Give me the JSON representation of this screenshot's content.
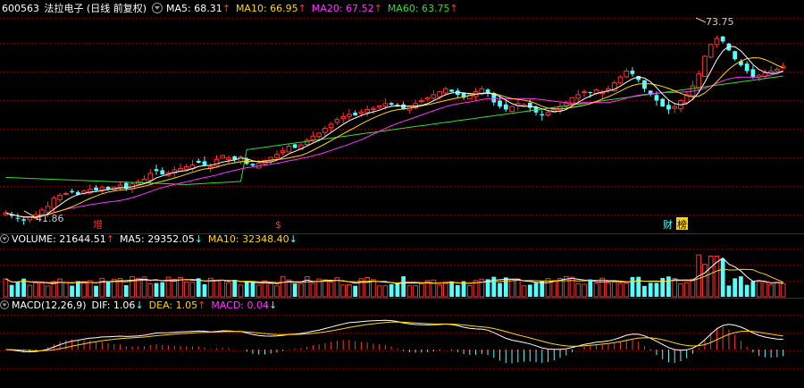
{
  "header": {
    "stock_code": "600563",
    "stock_name": "法拉电子",
    "period": "(日线 前复权)",
    "ma": [
      {
        "label": "MA5: 68.31",
        "color": "#ffffff"
      },
      {
        "label": "MA10: 66.95",
        "color": "#ffd700"
      },
      {
        "label": "MA20: 67.52",
        "color": "#ff33ff"
      },
      {
        "label": "MA60: 63.75",
        "color": "#33dd33"
      }
    ],
    "arrow_up": "↑",
    "arrow_down": "↓"
  },
  "volume_header": [
    {
      "label": "VOLUME: 21644.51",
      "color": "#ffffff",
      "arrow": "↑"
    },
    {
      "label": "MA5: 29352.05",
      "color": "#ffffff",
      "arrow": "↓"
    },
    {
      "label": "MA10: 32348.40",
      "color": "#ffd700",
      "arrow": "↓"
    }
  ],
  "macd_header": [
    {
      "label": "MACD(12,26,9)",
      "color": "#ffffff",
      "arrow": ""
    },
    {
      "label": "DIF: 1.06",
      "color": "#ffffff",
      "arrow": "↓"
    },
    {
      "label": "DEA: 1.05",
      "color": "#ffd700",
      "arrow": "↑"
    },
    {
      "label": "MACD: 0.04",
      "color": "#ff33ff",
      "arrow": "↓"
    }
  ],
  "annotations": {
    "high_label": "73.75",
    "low_label": "41.86",
    "marker_zeng": "增",
    "marker_s": "$",
    "marker_caibao": "财",
    "marker_bang": "榜"
  },
  "colors": {
    "up": "#ff3232",
    "down": "#54ffff",
    "ma5": "#ffffff",
    "ma10": "#ffd700",
    "ma20": "#ff33ff",
    "ma60": "#33dd33",
    "grid": "#8b0000"
  },
  "chart_data": {
    "type": "candlestick",
    "price_range": [
      40.5,
      76.5
    ],
    "price_close_series": [
      43.5,
      43.0,
      42.5,
      42.2,
      42.8,
      43.2,
      44.0,
      44.6,
      46.0,
      46.5,
      46.8,
      47.0,
      46.6,
      47.2,
      47.5,
      47.3,
      47.8,
      47.5,
      47.9,
      48.2,
      47.6,
      48.4,
      48.8,
      49.2,
      50.2,
      50.6,
      50.0,
      50.3,
      50.8,
      51.0,
      51.3,
      51.6,
      52.0,
      51.6,
      51.3,
      52.5,
      53.2,
      52.8,
      52.5,
      53.0,
      51.8,
      51.5,
      51.9,
      52.4,
      52.9,
      53.4,
      54.0,
      54.8,
      54.5,
      55.0,
      55.8,
      56.5,
      57.0,
      57.8,
      58.5,
      59.3,
      59.8,
      60.2,
      60.0,
      60.6,
      61.0,
      61.2,
      61.6,
      62.0,
      61.8,
      61.5,
      61.0,
      61.5,
      62.0,
      62.5,
      63.0,
      63.5,
      64.0,
      64.5,
      64.0,
      63.5,
      63.0,
      63.5,
      64.0,
      64.5,
      63.8,
      62.2,
      61.5,
      61.0,
      61.5,
      62.0,
      61.8,
      61.3,
      60.5,
      60.0,
      60.5,
      61.0,
      61.5,
      62.0,
      63.0,
      63.5,
      64.0,
      63.8,
      64.3,
      64.0,
      64.5,
      65.5,
      66.5,
      67.5,
      67.0,
      66.0,
      64.5,
      63.5,
      62.5,
      61.5,
      61.0,
      61.5,
      62.5,
      63.5,
      65.0,
      67.0,
      70.0,
      72.0,
      73.0,
      72.5,
      71.0,
      69.5,
      68.5,
      67.5,
      66.5,
      66.8,
      67.2,
      67.5,
      67.8,
      68.3
    ],
    "volume_range": [
      0,
      80000
    ],
    "macd_range": [
      -3.2,
      3.2
    ],
    "last_values": {
      "close": 68.31,
      "volume": 21644.51,
      "vol_ma5": 29352.05,
      "vol_ma10": 32348.4,
      "dif": 1.06,
      "dea": 1.05,
      "macd": 0.04
    }
  }
}
